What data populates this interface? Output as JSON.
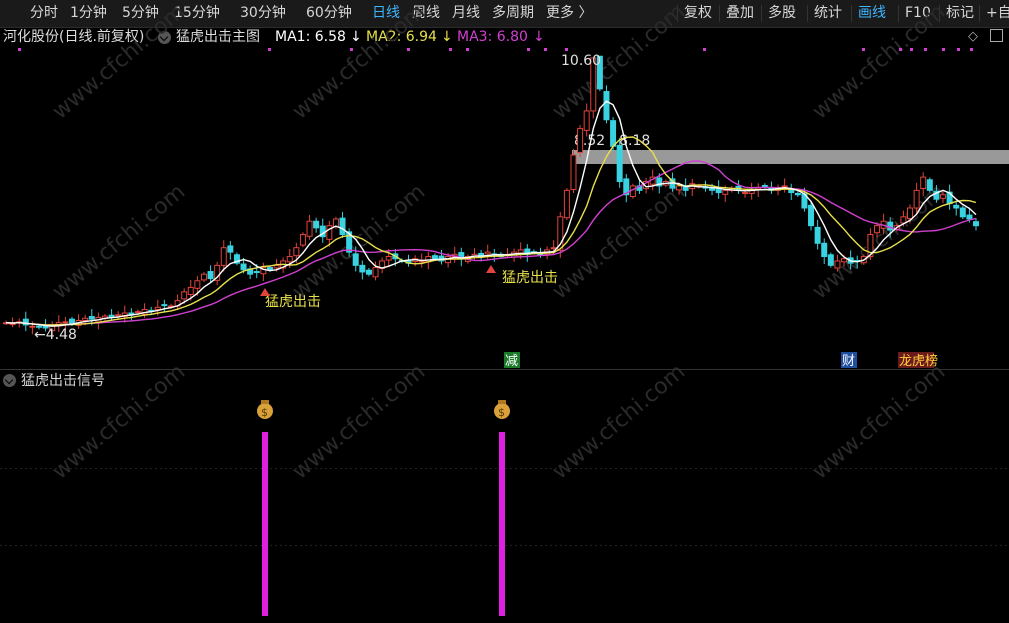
{
  "toolbar": {
    "periods": [
      "分时",
      "1分钟",
      "5分钟",
      "15分钟",
      "30分钟",
      "60分钟",
      "日线",
      "周线",
      "月线",
      "多周期",
      "更多 〉"
    ],
    "active_period": "日线",
    "actions": [
      "复权",
      "叠加",
      "多股",
      "统计",
      "画线",
      "F10",
      "标记",
      "+自"
    ],
    "active_action": "画线"
  },
  "chart_header": {
    "stock": "河化股份(日线.前复权)",
    "indicator_name": "猛虎出击主图",
    "ma1": "MA1: 6.58",
    "ma2": "MA2: 6.94",
    "ma3": "MA3: 6.80",
    "arrow": "↓"
  },
  "annotations": {
    "high_label": "10.60",
    "low_label": "←4.48",
    "zone_label": "8.52 - 8.18",
    "signal_label": "猛虎出击",
    "badge_jian": "减",
    "badge_cai": "财",
    "badge_long": "龙虎榜"
  },
  "sub_panel": {
    "title": "猛虎出击信号",
    "signal_icon": "money-bag-icon"
  },
  "watermark": "www.cfchi.com",
  "colors": {
    "background": "#000000",
    "up": "#e0443b",
    "down": "#38d2e0",
    "ma1": "#ffffff",
    "ma2": "#e8e04a",
    "ma3": "#d040d0",
    "signal_bar": "#e020e0",
    "active": "#3fb6ff",
    "zone": "#b4b4b4"
  },
  "chart_data": {
    "type": "candlestick",
    "title": "河化股份(日线.前复权)",
    "y_high": 10.6,
    "y_low": 4.48,
    "resistance_zone": [
      8.18,
      8.52
    ],
    "ma_values": {
      "MA1": 6.58,
      "MA2": 6.94,
      "MA3": 6.8
    },
    "closes": [
      4.6,
      4.58,
      4.62,
      4.55,
      4.52,
      4.5,
      4.48,
      4.55,
      4.6,
      4.62,
      4.58,
      4.65,
      4.7,
      4.68,
      4.72,
      4.75,
      4.72,
      4.78,
      4.82,
      4.8,
      4.85,
      4.9,
      4.88,
      4.95,
      5.0,
      4.98,
      5.1,
      5.3,
      5.4,
      5.55,
      5.7,
      5.6,
      5.9,
      6.3,
      6.2,
      5.95,
      5.8,
      5.7,
      5.75,
      5.85,
      5.8,
      5.9,
      6.0,
      6.1,
      6.3,
      6.6,
      6.9,
      6.75,
      6.55,
      6.8,
      6.95,
      6.6,
      6.2,
      5.9,
      5.75,
      5.7,
      5.85,
      6.0,
      6.1,
      6.05,
      6.0,
      5.95,
      6.05,
      6.0,
      6.1,
      6.05,
      6.0,
      6.1,
      6.15,
      6.05,
      6.1,
      6.15,
      6.1,
      6.2,
      6.15,
      6.1,
      6.15,
      6.2,
      6.25,
      6.15,
      6.2,
      6.15,
      6.25,
      6.3,
      7.0,
      7.6,
      8.4,
      9.0,
      9.4,
      10.6,
      9.9,
      9.2,
      8.6,
      7.8,
      7.5,
      7.7,
      7.6,
      7.8,
      7.9,
      7.7,
      7.8,
      7.65,
      7.7,
      7.6,
      7.75,
      7.7,
      7.65,
      7.6,
      7.55,
      7.6,
      7.65,
      7.6,
      7.55,
      7.6,
      7.65,
      7.7,
      7.6,
      7.65,
      7.7,
      7.55,
      7.5,
      7.2,
      6.8,
      6.4,
      6.1,
      5.9,
      6.0,
      6.05,
      5.95,
      6.0,
      6.1,
      6.6,
      6.8,
      6.9,
      6.7,
      6.8,
      7.0,
      7.2,
      7.6,
      7.9,
      7.6,
      7.4,
      7.5,
      7.3,
      7.2,
      7.0,
      6.95,
      6.8
    ],
    "signals": [
      {
        "index": 38,
        "label": "猛虎出击"
      },
      {
        "index": 83,
        "label": "猛虎出击"
      }
    ]
  }
}
